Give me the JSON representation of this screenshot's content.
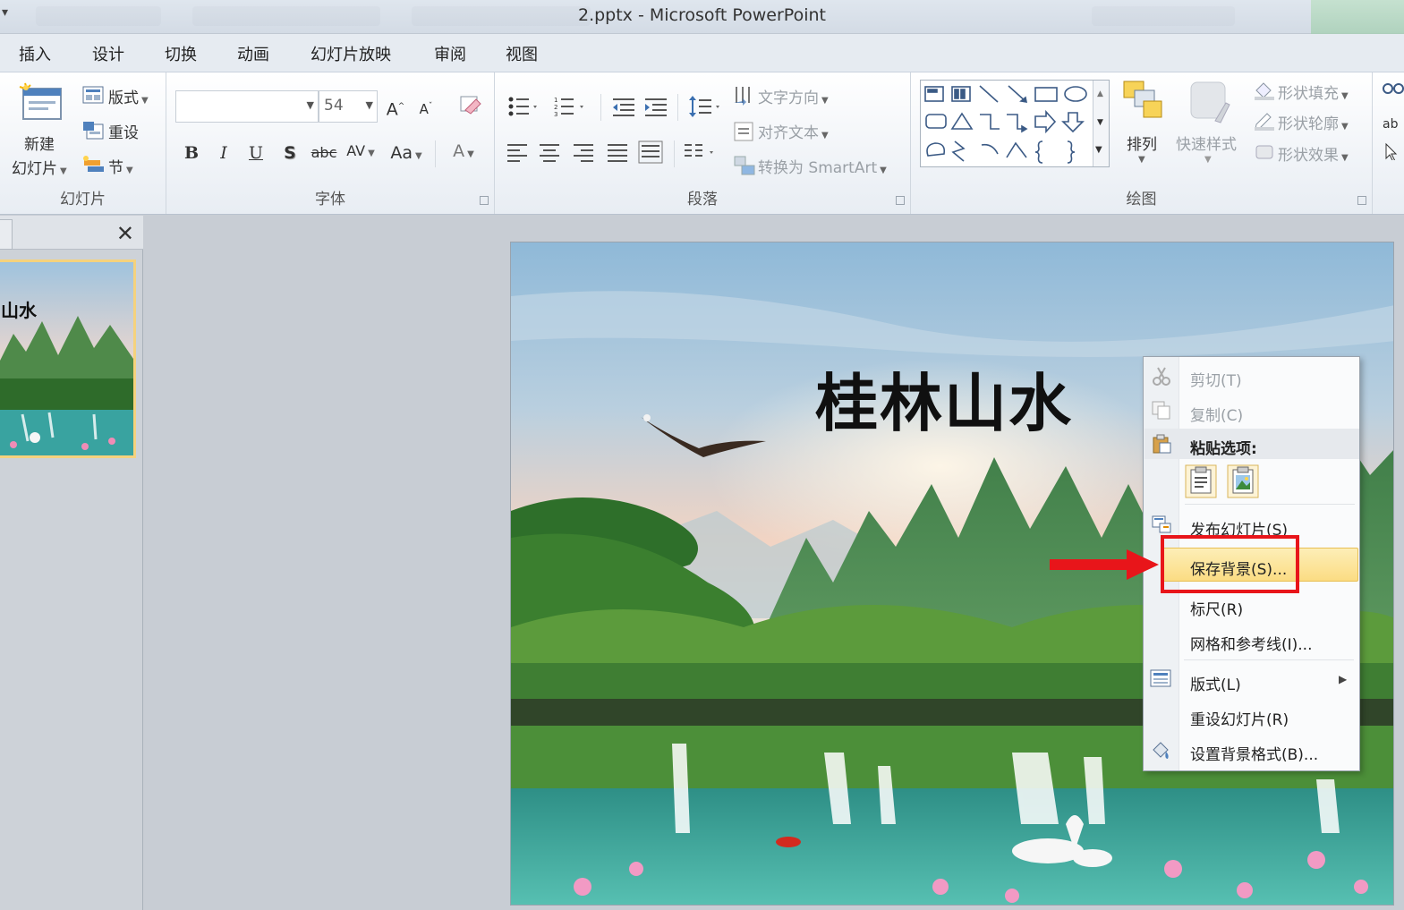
{
  "window": {
    "title": "2.pptx  -  Microsoft PowerPoint"
  },
  "tabs": [
    "插入",
    "设计",
    "切换",
    "动画",
    "幻灯片放映",
    "审阅",
    "视图"
  ],
  "groups": {
    "slides": {
      "label": "幻灯片",
      "new_slide_line1": "新建",
      "new_slide_line2": "幻灯片",
      "layout": "版式",
      "reset": "重设",
      "section": "节"
    },
    "font": {
      "label": "字体",
      "font_name": "",
      "font_size": "54",
      "bold": "B",
      "italic": "I",
      "underline": "U",
      "shadow": "S",
      "strike": "abc",
      "spacing": "AV",
      "case": "Aa",
      "color": "A",
      "grow": "A",
      "shrink": "A"
    },
    "paragraph": {
      "label": "段落",
      "text_direction": "文字方向",
      "align_text": "对齐文本",
      "convert_smartart": "转换为 SmartArt"
    },
    "drawing": {
      "label": "绘图",
      "arrange": "排列",
      "quick_styles": "快速样式",
      "shape_fill": "形状填充",
      "shape_outline": "形状轮廓",
      "shape_effects": "形状效果"
    }
  },
  "slide": {
    "title": "桂林山水"
  },
  "thumbnail": {
    "title": "山水"
  },
  "context_menu": {
    "cut": "剪切(T)",
    "copy": "复制(C)",
    "paste_options": "粘贴选项:",
    "publish": "发布幻灯片(S)",
    "save_background": "保存背景(S)...",
    "ruler": "标尺(R)",
    "grid": "网格和参考线(I)...",
    "layout": "版式(L)",
    "reset_slide": "重设幻灯片(R)",
    "format_background": "设置背景格式(B)..."
  },
  "colors": {
    "highlight": "#fbdc83",
    "annotation_red": "#e8151a",
    "selected_thumb": "#f5d27d"
  }
}
